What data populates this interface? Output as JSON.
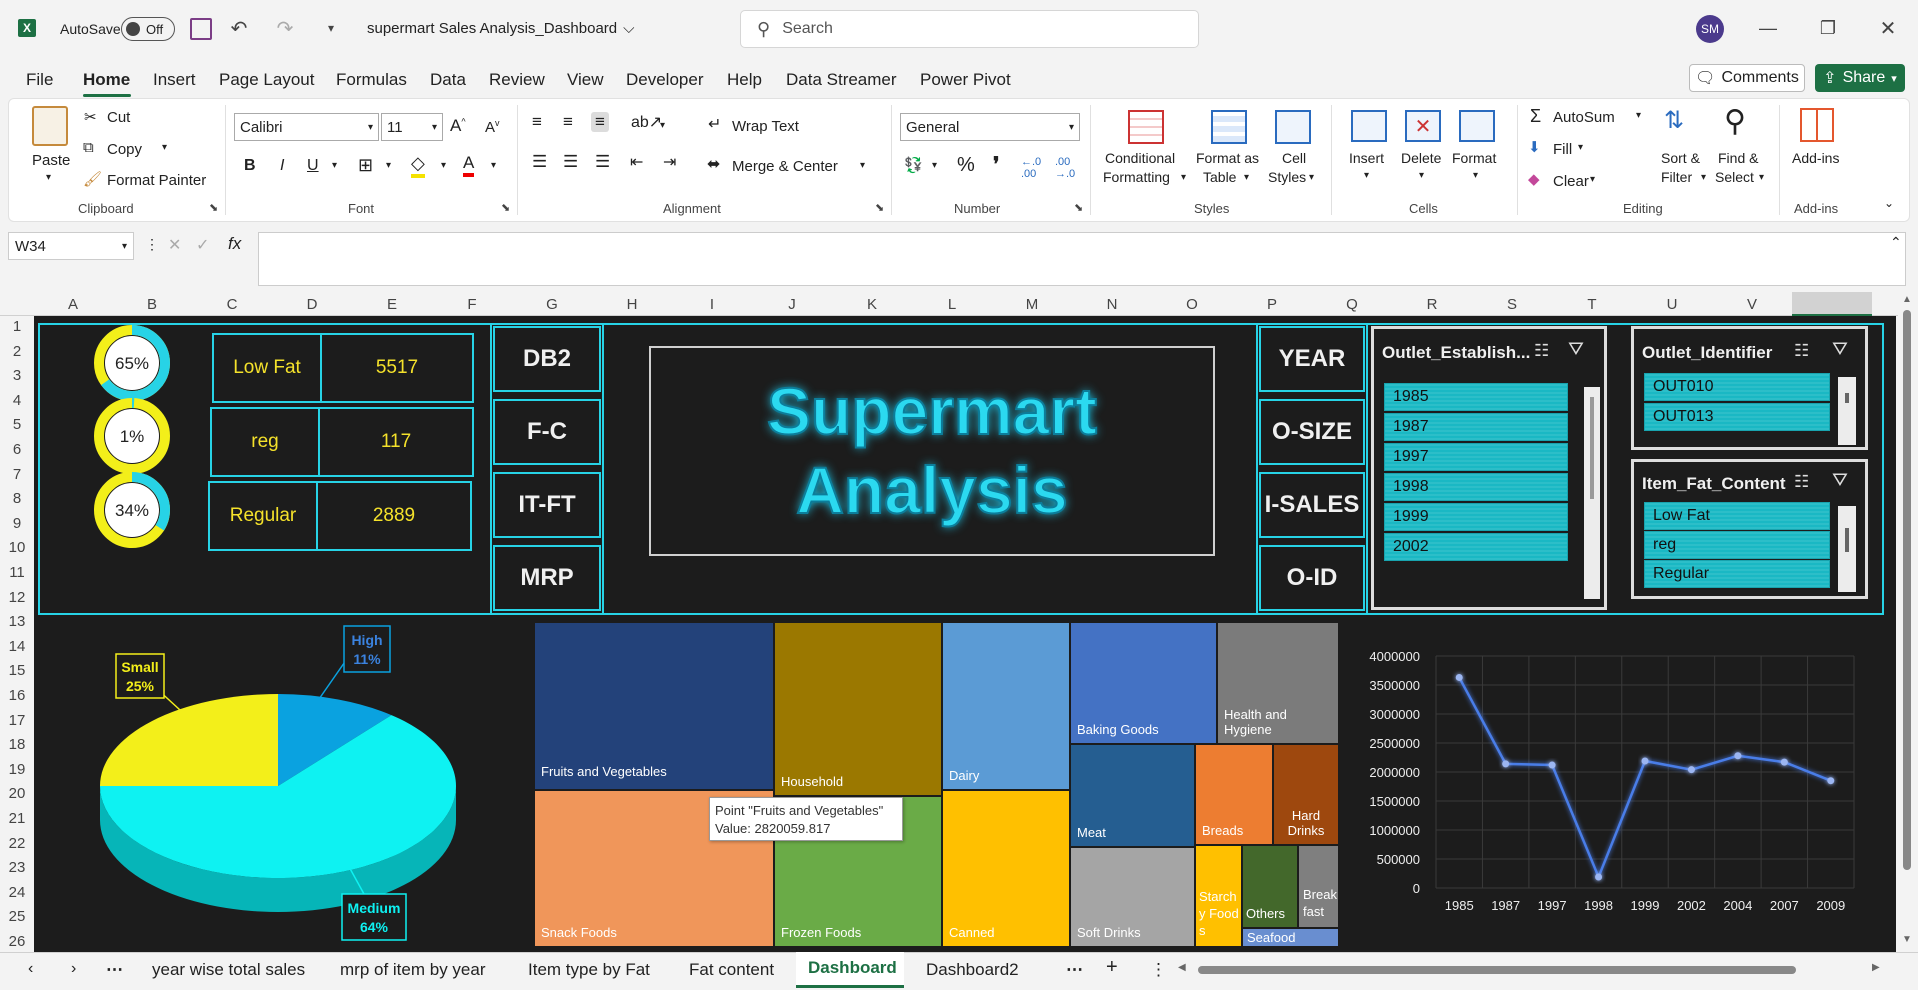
{
  "titlebar": {
    "autosave_label": "AutoSave",
    "autosave_state": "Off",
    "file_title": "supermart Sales Analysis_Dashboard",
    "search_placeholder": "Search",
    "user_initials": "SM"
  },
  "menu": [
    "File",
    "Home",
    "Insert",
    "Page Layout",
    "Formulas",
    "Data",
    "Review",
    "View",
    "Developer",
    "Help",
    "Data Streamer",
    "Power Pivot"
  ],
  "menu_right": {
    "comments": "Comments",
    "share": "Share"
  },
  "ribbon": {
    "clipboard": {
      "paste": "Paste",
      "cut": "Cut",
      "copy": "Copy",
      "format_painter": "Format Painter",
      "label": "Clipboard"
    },
    "font": {
      "name": "Calibri",
      "size": "11",
      "label": "Font",
      "bold": "B",
      "italic": "I",
      "underline": "U"
    },
    "alignment": {
      "wrap": "Wrap Text",
      "merge": "Merge & Center",
      "label": "Alignment"
    },
    "number": {
      "format": "General",
      "label": "Number"
    },
    "styles": {
      "cond": "Conditional",
      "cond2": "Formatting",
      "fmt_table": "Format as",
      "fmt_table2": "Table",
      "cell_styles": "Cell",
      "cell_styles2": "Styles",
      "label": "Styles"
    },
    "cells": {
      "insert": "Insert",
      "delete": "Delete",
      "format": "Format",
      "label": "Cells"
    },
    "editing": {
      "autosum": "AutoSum",
      "fill": "Fill",
      "clear": "Clear",
      "sort": "Sort &",
      "sort2": "Filter",
      "find": "Find &",
      "find2": "Select",
      "label": "Editing"
    },
    "addins": {
      "addins": "Add-ins",
      "label": "Add-ins"
    }
  },
  "formula_bar": {
    "name_box": "W34",
    "fx": "fx",
    "value": ""
  },
  "columns": [
    "A",
    "B",
    "C",
    "D",
    "E",
    "F",
    "G",
    "H",
    "I",
    "J",
    "K",
    "L",
    "M",
    "N",
    "O",
    "P",
    "Q",
    "R",
    "S",
    "T",
    "U",
    "V",
    "W"
  ],
  "rows": [
    "1",
    "2",
    "3",
    "4",
    "5",
    "6",
    "7",
    "8",
    "9",
    "10",
    "11",
    "12",
    "13",
    "14",
    "15",
    "16",
    "17",
    "18",
    "19",
    "20",
    "21",
    "22",
    "23",
    "24",
    "25",
    "26"
  ],
  "dashboard": {
    "kpis": [
      {
        "pct": "65%",
        "fraction": 0.65,
        "label": "Low Fat",
        "value": "5517"
      },
      {
        "pct": "1%",
        "fraction": 0.01,
        "label": "reg",
        "value": "117"
      },
      {
        "pct": "34%",
        "fraction": 0.34,
        "label": "Regular",
        "value": "2889"
      }
    ],
    "nav_left": [
      "DB2",
      "F-C",
      "IT-FT",
      "MRP"
    ],
    "title_line1": "Supermart",
    "title_line2": "Analysis",
    "nav_right": [
      "YEAR",
      "O-SIZE",
      "I-SALES",
      "O-ID"
    ],
    "slicer_year": {
      "title": "Outlet_Establish...",
      "items": [
        "1985",
        "1987",
        "1997",
        "1998",
        "1999",
        "2002"
      ]
    },
    "slicer_outlet": {
      "title": "Outlet_Identifier",
      "items": [
        "OUT010",
        "OUT013"
      ]
    },
    "slicer_fat": {
      "title": "Item_Fat_Content",
      "items": [
        "Low Fat",
        "reg",
        "Regular"
      ]
    }
  },
  "pie_labels": {
    "small": "Small",
    "small_pct": "25%",
    "high": "High",
    "high_pct": "11%",
    "medium": "Medium",
    "medium_pct": "64%"
  },
  "treemap_labels": [
    "Fruits and Vegetables",
    "Household",
    "Dairy",
    "Baking Goods",
    "Health and Hygiene",
    "Snack Foods",
    "Frozen Foods",
    "Canned",
    "Meat",
    "Breads",
    "Hard Drinks",
    "Soft Drinks",
    "Starchy Foods",
    "Others",
    "Breakfast",
    "Seafood"
  ],
  "tooltip": {
    "line1": "Point \"Fruits and Vegetables\"",
    "line2": "Value: 2820059.817"
  },
  "chart_data": [
    {
      "type": "pie",
      "categories": [
        "Small",
        "High",
        "Medium"
      ],
      "values": [
        25,
        11,
        64
      ],
      "colors": [
        "#f3ef1a",
        "#0aa2e0",
        "#0ef2f2"
      ]
    },
    {
      "type": "bar",
      "subtype": "treemap",
      "categories": [
        "Fruits and Vegetables",
        "Snack Foods",
        "Household",
        "Frozen Foods",
        "Dairy",
        "Canned",
        "Baking Goods",
        "Health and Hygiene",
        "Meat",
        "Soft Drinks",
        "Breads",
        "Hard Drinks",
        "Starchy Foods",
        "Others",
        "Breakfast",
        "Seafood"
      ],
      "highlight": {
        "category": "Fruits and Vegetables",
        "value": 2820059.817
      }
    },
    {
      "type": "line",
      "categories": [
        "1985",
        "1987",
        "1997",
        "1998",
        "1999",
        "2002",
        "2004",
        "2007",
        "2009"
      ],
      "series": [
        {
          "values": [
            3630000,
            2140000,
            2120000,
            190000,
            2190000,
            2040000,
            2280000,
            2170000,
            1850000
          ]
        }
      ],
      "ylim": [
        0,
        4000000
      ],
      "yticks": [
        "0",
        "500000",
        "1000000",
        "1500000",
        "2000000",
        "2500000",
        "3000000",
        "3500000",
        "4000000"
      ],
      "grid": true,
      "color": "#4a7de8"
    }
  ],
  "tabs": [
    "year wise total sales",
    "mrp of item by year",
    "Item type by Fat",
    "Fat content",
    "Dashboard",
    "Dashboard2"
  ],
  "active_tab": "Dashboard"
}
